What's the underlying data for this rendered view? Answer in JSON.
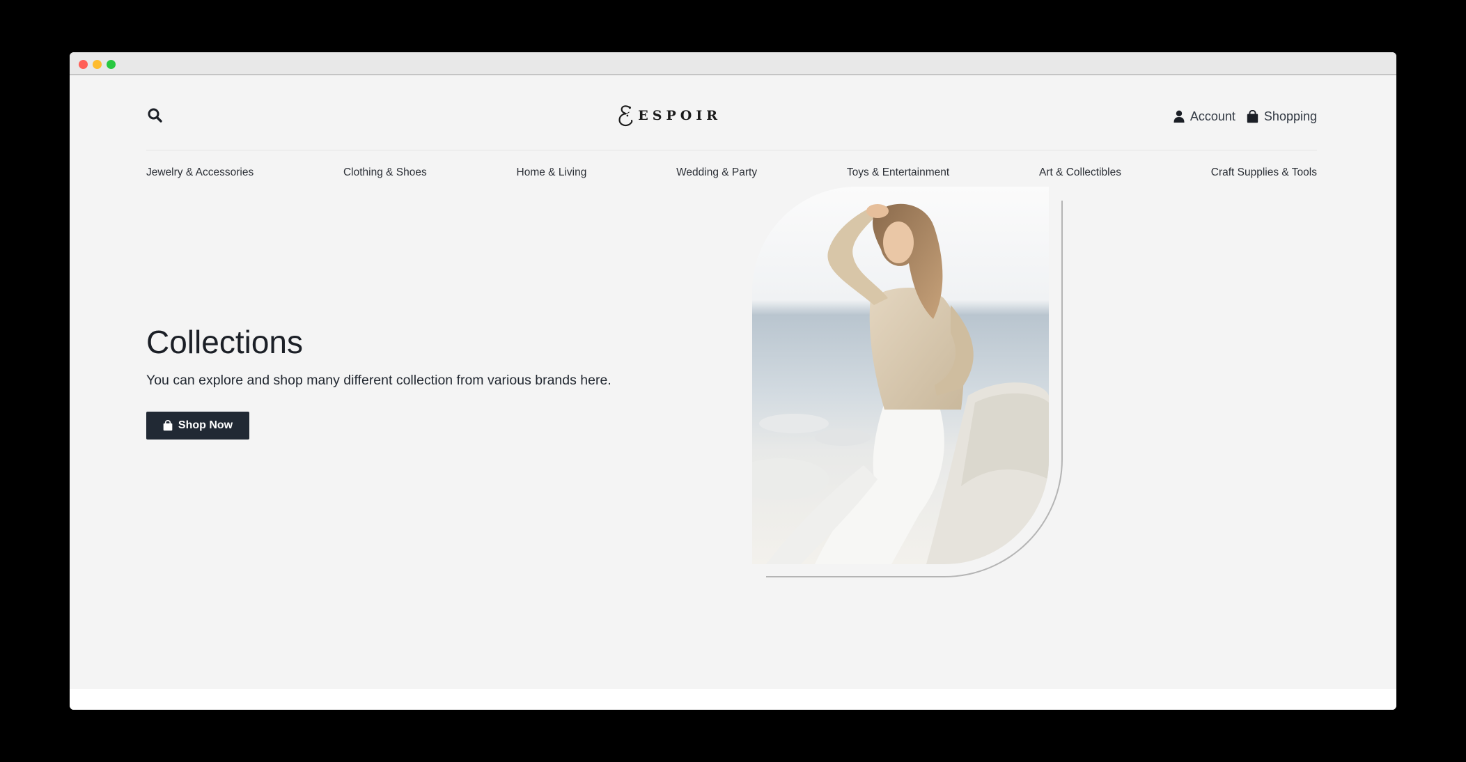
{
  "brand": {
    "name": "ESPOIR",
    "logo_icon": "espoir-e-monogram"
  },
  "header": {
    "search_icon": "search-icon",
    "account_label": "Account",
    "account_icon": "user-icon",
    "shopping_label": "Shopping",
    "shopping_icon": "shopping-bag-icon"
  },
  "nav": {
    "items": [
      {
        "label": "Jewelry & Accessories"
      },
      {
        "label": "Clothing & Shoes"
      },
      {
        "label": "Home & Living"
      },
      {
        "label": "Wedding & Party"
      },
      {
        "label": "Toys & Entertainment"
      },
      {
        "label": "Art & Collectibles"
      },
      {
        "label": "Craft Supplies & Tools"
      }
    ]
  },
  "hero": {
    "title": "Collections",
    "subtitle": "You can explore and shop many different collection from various brands here.",
    "cta_label": "Shop Now",
    "cta_icon": "shopping-bag-icon"
  },
  "colors": {
    "page_bg": "#f4f4f4",
    "button_bg": "#212934",
    "text_primary": "#1b1f26",
    "frame_line": "#b4b4b4"
  }
}
